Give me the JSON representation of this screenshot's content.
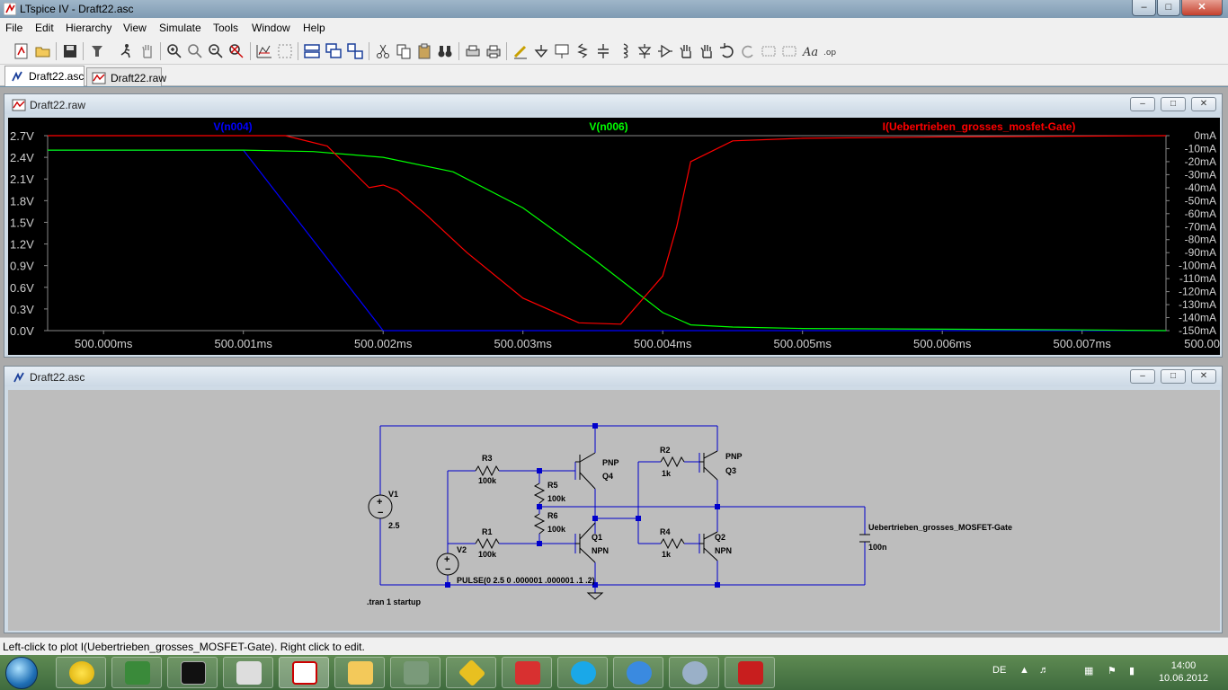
{
  "window": {
    "title": "LTspice IV - Draft22.asc"
  },
  "menu": [
    "File",
    "Edit",
    "Hierarchy",
    "View",
    "Simulate",
    "Tools",
    "Window",
    "Help"
  ],
  "tabs": [
    {
      "label": "Draft22.asc",
      "icon": "schematic-icon",
      "active": true
    },
    {
      "label": "Draft22.raw",
      "icon": "waveform-icon",
      "active": false
    }
  ],
  "plot_window": {
    "title": "Draft22.raw"
  },
  "schematic_window": {
    "title": "Draft22.asc"
  },
  "chart_data": {
    "type": "line",
    "title": "",
    "xlabel": "",
    "ylabel_left": "",
    "ylabel_right": "",
    "x_ticks": [
      "500.000ms",
      "500.001ms",
      "500.002ms",
      "500.003ms",
      "500.004ms",
      "500.005ms",
      "500.006ms",
      "500.007ms",
      "500.00"
    ],
    "x_tick_us": [
      0,
      1,
      2,
      3,
      4,
      5,
      6,
      7,
      8
    ],
    "xlim_us": [
      -0.4,
      7.6
    ],
    "y_left_ticks": [
      "2.7V",
      "2.4V",
      "2.1V",
      "1.8V",
      "1.5V",
      "1.2V",
      "0.9V",
      "0.6V",
      "0.3V",
      "0.0V"
    ],
    "ylim_left": [
      0,
      2.7
    ],
    "y_right_ticks": [
      "0mA",
      "-10mA",
      "-20mA",
      "-30mA",
      "-40mA",
      "-50mA",
      "-60mA",
      "-70mA",
      "-80mA",
      "-90mA",
      "-100mA",
      "-110mA",
      "-120mA",
      "-130mA",
      "-140mA",
      "-150mA"
    ],
    "ylim_right": [
      -150,
      0
    ],
    "series": [
      {
        "name": "V(n004)",
        "color": "#0000ff",
        "axis": "left",
        "x": [
          -0.4,
          0.0,
          0.5,
          1.0,
          2.0,
          2.5,
          7.6
        ],
        "y": [
          2.5,
          2.5,
          2.5,
          2.5,
          0.0,
          0.0,
          0.0
        ]
      },
      {
        "name": "V(n006)",
        "color": "#00ff00",
        "axis": "left",
        "x": [
          -0.4,
          0.5,
          1.0,
          1.5,
          2.0,
          2.5,
          3.0,
          3.5,
          4.0,
          4.2,
          4.5,
          5.0,
          6.0,
          7.0,
          7.6
        ],
        "y": [
          2.5,
          2.5,
          2.5,
          2.48,
          2.4,
          2.2,
          1.7,
          1.0,
          0.25,
          0.08,
          0.05,
          0.03,
          0.02,
          0.01,
          0.0
        ]
      },
      {
        "name": "I(Uebertrieben_grosses_mosfet-Gate)",
        "color": "#ff0000",
        "axis": "right",
        "x": [
          -0.4,
          1.3,
          1.6,
          1.9,
          2.0,
          2.1,
          2.3,
          2.6,
          3.0,
          3.4,
          3.7,
          4.0,
          4.1,
          4.2,
          4.5,
          5.0,
          6.0,
          7.6
        ],
        "y": [
          0,
          0,
          -8,
          -40,
          -38,
          -42,
          -60,
          -90,
          -125,
          -144,
          -145,
          -108,
          -70,
          -20,
          -4,
          -2,
          -1,
          0
        ]
      }
    ]
  },
  "schematic": {
    "labels": {
      "R3": "R3",
      "R3v": "100k",
      "R5": "R5",
      "R5v": "100k",
      "R6": "R6",
      "R6v": "100k",
      "R1": "R1",
      "R1v": "100k",
      "R2": "R2",
      "R2v": "1k",
      "R4": "R4",
      "R4v": "1k",
      "Q4": "Q4",
      "Q4t": "PNP",
      "Q3": "Q3",
      "Q3t": "PNP",
      "Q1": "Q1",
      "Q1t": "NPN",
      "Q2": "Q2",
      "Q2t": "NPN",
      "V1": "V1",
      "V1v": "2.5",
      "V2": "V2",
      "V2v": "PULSE(0 2.5 0 .000001 .000001 .1 .2)",
      "C": "Uebertrieben_grosses_MOSFET-Gate",
      "Cv": "100n",
      "tran": ".tran 1 startup"
    }
  },
  "status": {
    "text": "Left-click to plot I(Uebertrieben_grosses_MOSFET-Gate).  Right click to edit."
  },
  "taskbar": {
    "apps": [
      "lemon-icon",
      "avr-studio-icon",
      "command-prompt-icon",
      "hxd-icon",
      "ltspice-icon",
      "file-explorer-icon",
      "device-manager-icon",
      "game-icon",
      "flashget-icon",
      "skype-icon",
      "internet-explorer-icon",
      "media-icon",
      "acrobat-icon"
    ],
    "language": "DE",
    "time": "14:00",
    "date": "10.06.2012"
  }
}
